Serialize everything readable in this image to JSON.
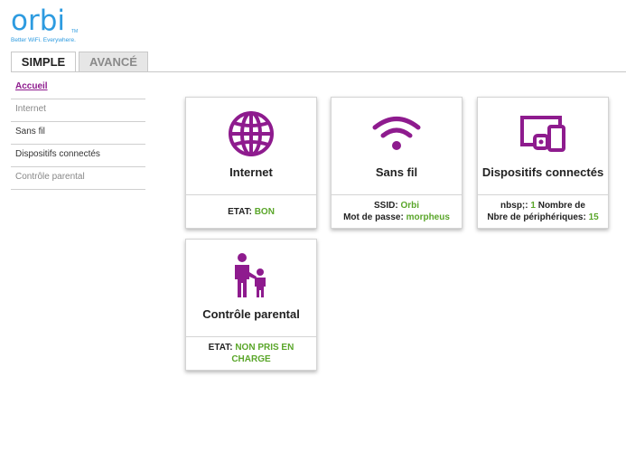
{
  "brand": {
    "name": "orbi",
    "tm": "TM",
    "tagline": "Better WiFi. Everywhere."
  },
  "tabs": [
    {
      "label": "SIMPLE",
      "active": true
    },
    {
      "label": "AVANCÉ",
      "active": false
    }
  ],
  "sidebar": {
    "items": [
      {
        "label": "Accueil",
        "active": true
      },
      {
        "label": "Internet"
      },
      {
        "label": "Sans fil"
      },
      {
        "label": "Dispositifs connectés"
      },
      {
        "label": "Contrôle parental"
      }
    ]
  },
  "cards": {
    "internet": {
      "title": "Internet",
      "status_label": "ETAT:",
      "status_value": "BON"
    },
    "wireless": {
      "title": "Sans fil",
      "ssid_label": "SSID:",
      "ssid_value": "Orbi",
      "password_label": "Mot de passe:",
      "password_value": "morpheus"
    },
    "devices": {
      "title": "Dispositifs connectés",
      "line1_prefix": "nbsp;:",
      "line1_value": "1",
      "line1_suffix": "Nombre de",
      "line2_label": "Nbre de périphériques:",
      "line2_value": "15"
    },
    "parental": {
      "title": "Contrôle parental",
      "status_label": "ETAT:",
      "status_value_line1": "NON PRIS EN",
      "status_value_line2": "CHARGE"
    }
  },
  "colors": {
    "accent": "#8e1b8e",
    "brand": "#2d9be0",
    "status_ok": "#5aa62a"
  }
}
